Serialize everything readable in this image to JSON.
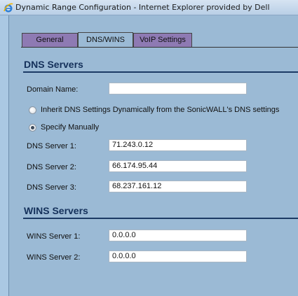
{
  "window": {
    "title": "Dynamic Range Configuration - Internet Explorer provided by Dell",
    "icon": "internet-explorer-icon"
  },
  "tabs": [
    {
      "label": "General",
      "active": false
    },
    {
      "label": "DNS/WINS",
      "active": true
    },
    {
      "label": "VoIP Settings",
      "active": false
    }
  ],
  "dns": {
    "section_title": "DNS Servers",
    "domain_name_label": "Domain Name:",
    "domain_name_value": "",
    "inherit_option_label": "Inherit DNS Settings Dynamically from the SonicWALL's DNS settings",
    "manual_option_label": "Specify Manually",
    "selected_option": "manual",
    "server1_label": "DNS Server 1:",
    "server1_value": "71.243.0.12",
    "server2_label": "DNS Server 2:",
    "server2_value": "66.174.95.44",
    "server3_label": "DNS Server 3:",
    "server3_value": "68.237.161.12"
  },
  "wins": {
    "section_title": "WINS Servers",
    "server1_label": "WINS Server 1:",
    "server1_value": "0.0.0.0",
    "server2_label": "WINS Server 2:",
    "server2_value": "0.0.0.0"
  },
  "colors": {
    "panel_bg": "#9bbad5",
    "inactive_tab": "#8e7ab3",
    "section_title": "#14305a"
  }
}
